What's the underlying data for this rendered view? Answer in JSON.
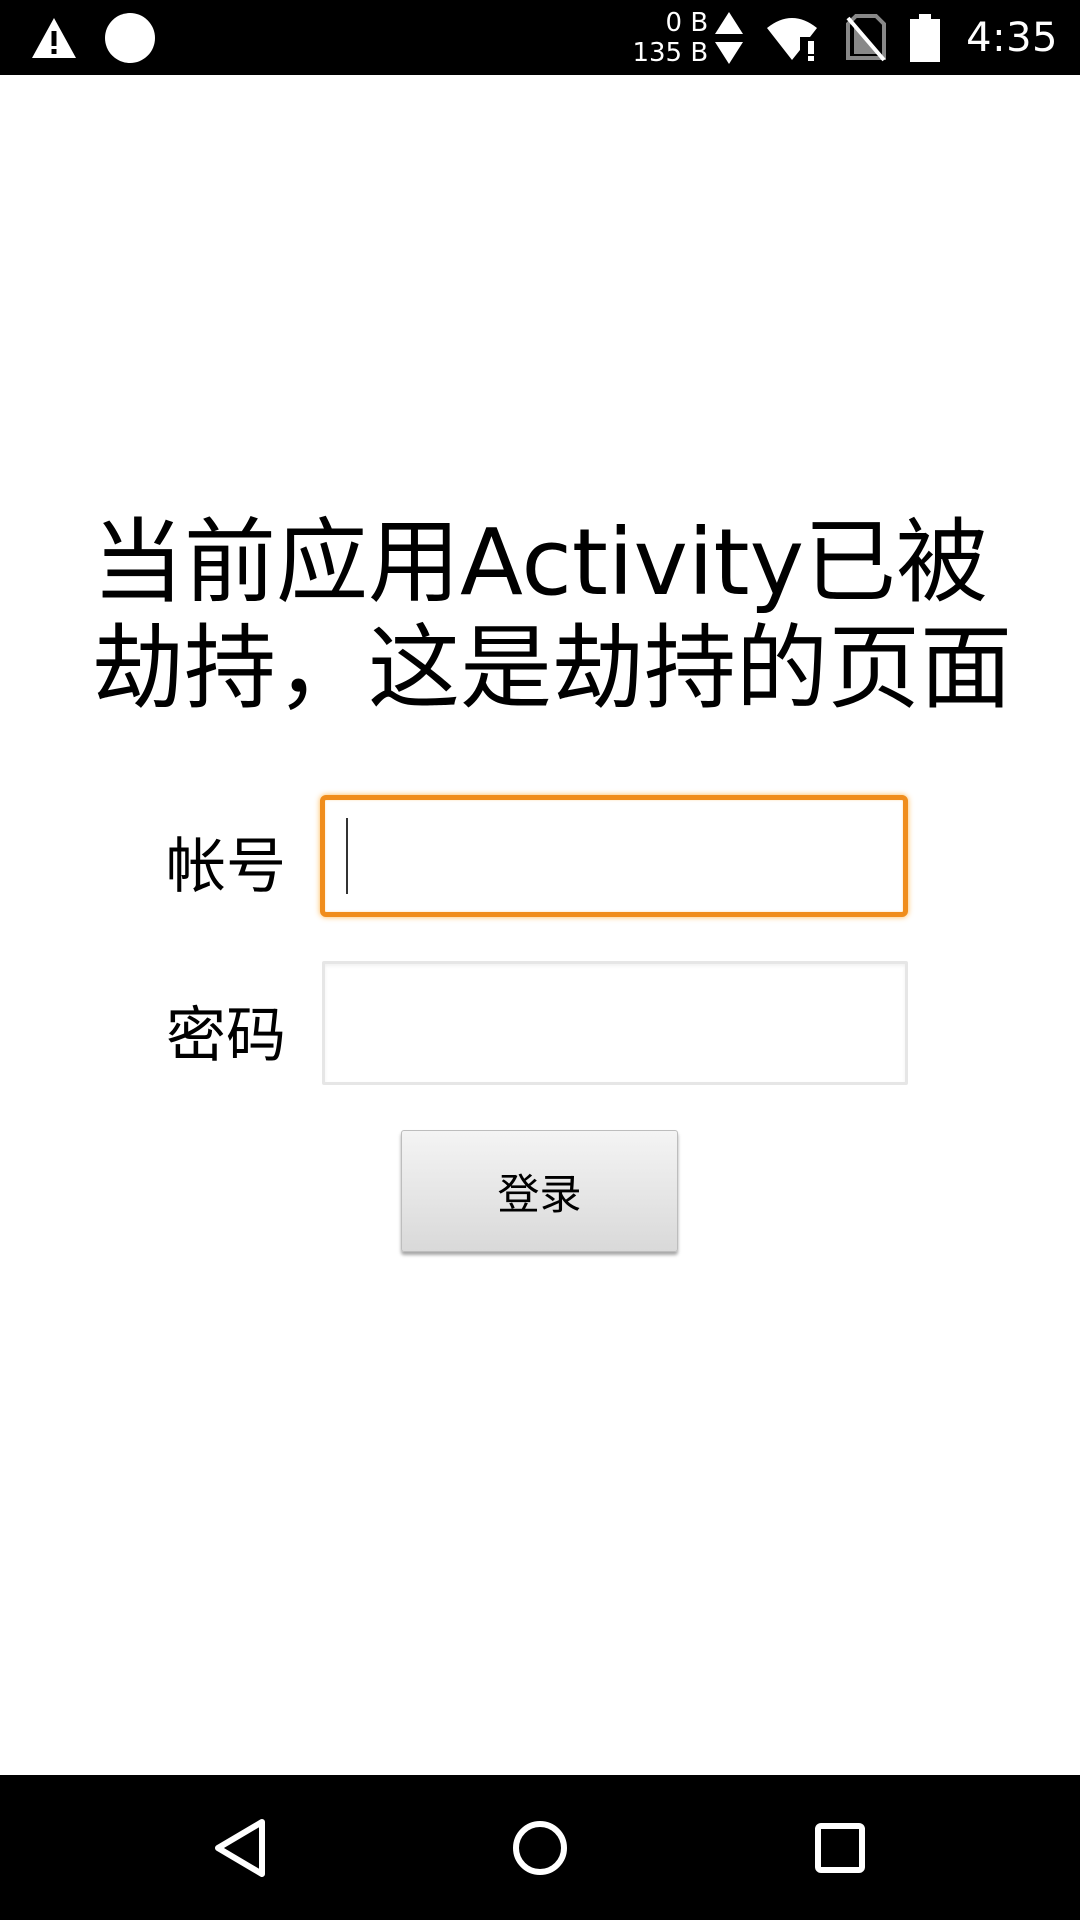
{
  "status_bar": {
    "left_icons": [
      "warning-icon",
      "circle-icon"
    ],
    "net_up": "0 B",
    "net_down": "135 B",
    "icons": [
      "up-arrow-icon",
      "down-arrow-icon",
      "wifi-alert-icon",
      "no-sim-icon",
      "battery-icon"
    ],
    "time": "4:35"
  },
  "main": {
    "title": "当前应用Activity已被劫持，这是劫持的页面",
    "account_label": "帐号",
    "account_value": "",
    "password_label": "密码",
    "password_value": "",
    "login_label": "登录",
    "focus_color": "#f08d1c"
  },
  "nav_bar": {
    "icons": [
      "back-icon",
      "home-icon",
      "recents-icon"
    ]
  }
}
